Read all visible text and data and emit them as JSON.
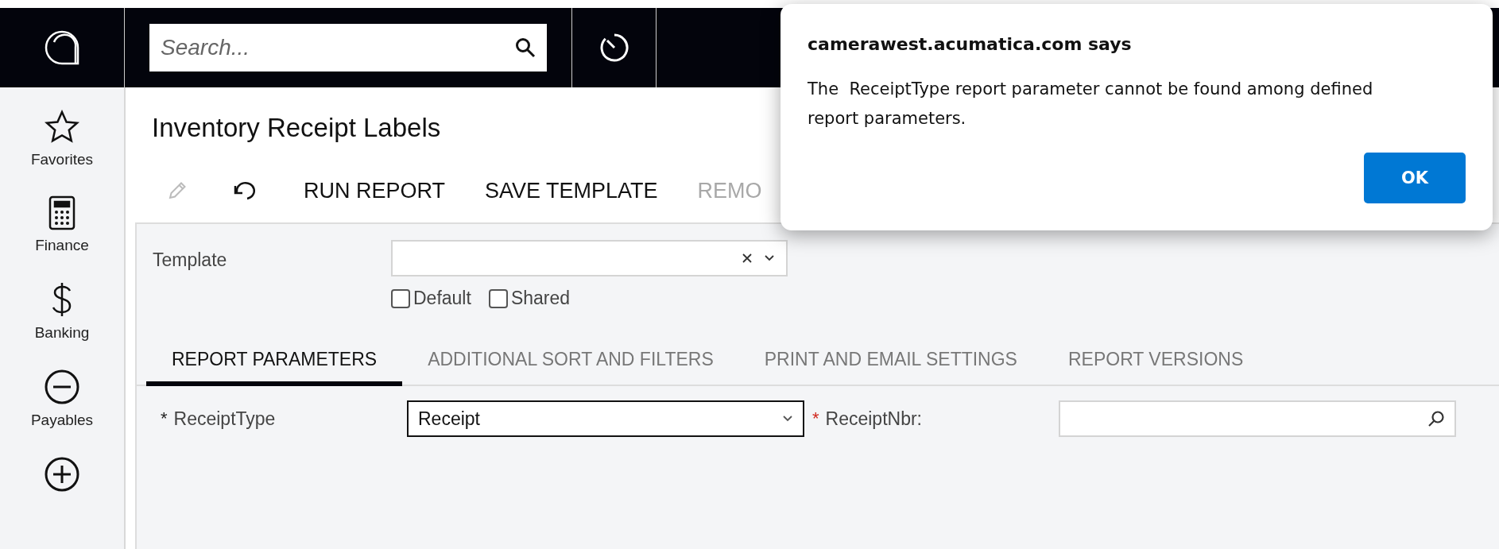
{
  "topbar": {
    "search": {
      "placeholder": "Search..."
    }
  },
  "sidebar": {
    "items": [
      {
        "label": "Favorites",
        "kind": "star"
      },
      {
        "label": "Finance",
        "kind": "calculator"
      },
      {
        "label": "Banking",
        "kind": "dollar"
      },
      {
        "label": "Payables",
        "kind": "minus"
      },
      {
        "kind": "plus"
      }
    ]
  },
  "page": {
    "title": "Inventory Receipt Labels"
  },
  "toolbar": [
    {
      "kind": "edit",
      "disabled": true
    },
    {
      "kind": "undo",
      "disabled": false
    },
    {
      "kind": "text",
      "label": "RUN REPORT",
      "disabled": false
    },
    {
      "kind": "text",
      "label": "SAVE TEMPLATE",
      "disabled": false
    },
    {
      "kind": "text",
      "label": "REMO",
      "disabled": true
    }
  ],
  "template": {
    "label": "Template",
    "options": [
      {
        "label": "Default",
        "checked": false
      },
      {
        "label": "Shared",
        "checked": false
      }
    ]
  },
  "tabs": [
    {
      "label": "REPORT PARAMETERS",
      "selected": true
    },
    {
      "label": "ADDITIONAL SORT AND FILTERS",
      "selected": false
    },
    {
      "label": "PRINT AND EMAIL SETTINGS",
      "selected": false
    },
    {
      "label": "REPORT VERSIONS",
      "selected": false
    }
  ],
  "parameters": [
    {
      "label": "ReceiptType",
      "required": true,
      "marker": "*",
      "color": "#222222",
      "kind": "select",
      "value": "Receipt",
      "focused": true
    },
    {
      "label": "ReceiptNbr:",
      "required": true,
      "marker": "*",
      "color": "#d0271d",
      "kind": "lookup",
      "focused": false
    }
  ],
  "dialog": {
    "title": "camerawest.acumatica.com says",
    "message": "The  ReceiptType report parameter cannot be found among defined report parameters.",
    "button": "OK"
  }
}
